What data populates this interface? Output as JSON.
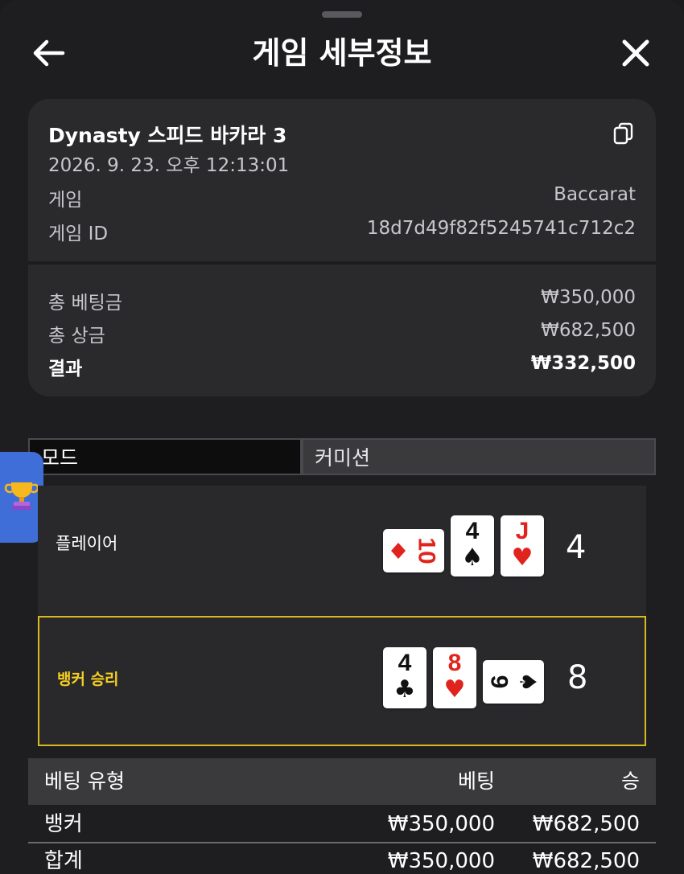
{
  "header": {
    "title": "게임 세부정보"
  },
  "game": {
    "name": "Dynasty 스피드 바카라 3",
    "date": "2026. 9. 23. 오후 12:13:01",
    "type_label": "게임",
    "type_value": "Baccarat",
    "id_label": "게임 ID",
    "id_value": "18d7d49f82f5245741c712c2"
  },
  "summary": {
    "total_bet_label": "총 베팅금",
    "total_bet_value": "₩350,000",
    "total_win_label": "총 상금",
    "total_win_value": "₩682,500",
    "result_label": "결과",
    "result_value": "₩332,500"
  },
  "tabs": {
    "mode": "모드",
    "commission": "커미션"
  },
  "player": {
    "label": "플레이어",
    "score": "4",
    "cards": [
      {
        "rank": "10",
        "suit": "♦",
        "color": "red",
        "orientation": "sideways"
      },
      {
        "rank": "4",
        "suit": "♠",
        "color": "black",
        "orientation": "upright"
      },
      {
        "rank": "J",
        "suit": "♥",
        "color": "red",
        "orientation": "upright"
      }
    ]
  },
  "banker": {
    "label": "뱅커 승리",
    "score": "8",
    "cards": [
      {
        "rank": "4",
        "suit": "♣",
        "color": "black",
        "orientation": "upright"
      },
      {
        "rank": "8",
        "suit": "♥",
        "color": "red",
        "orientation": "upright"
      },
      {
        "rank": "9",
        "suit": "♠",
        "color": "black",
        "orientation": "sideways"
      }
    ]
  },
  "bets": {
    "headers": [
      "베팅 유형",
      "베팅",
      "승"
    ],
    "rows": [
      {
        "type": "뱅커",
        "bet": "₩350,000",
        "win": "₩682,500"
      },
      {
        "type": "합계",
        "bet": "₩350,000",
        "win": "₩682,500"
      }
    ]
  },
  "colors": {
    "accent_gold": "#f5cf22",
    "card_red": "#e0241d",
    "panel": "#2a2a2d",
    "trophy_tab": "#3f6ed8"
  },
  "icons": [
    "back-arrow-icon",
    "close-icon",
    "copy-icon",
    "trophy-icon"
  ]
}
